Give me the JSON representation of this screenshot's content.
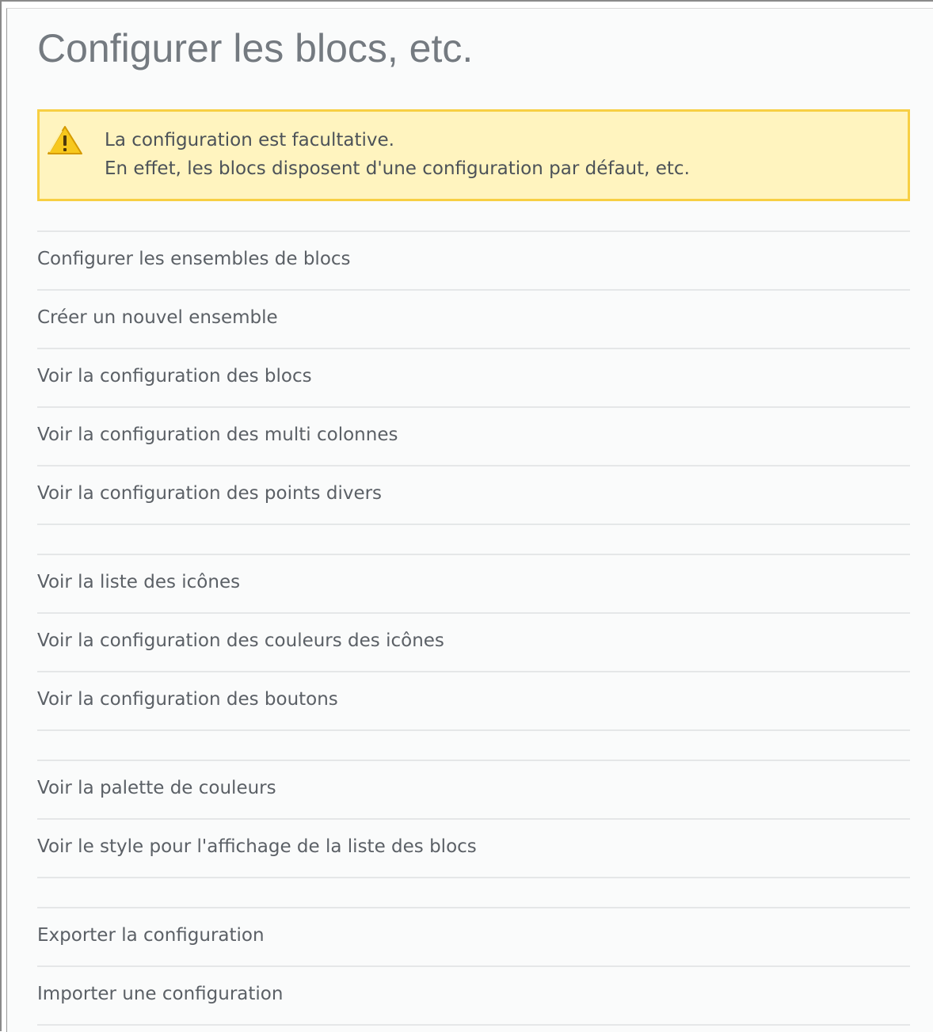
{
  "page": {
    "title": "Configurer les blocs, etc."
  },
  "warning": {
    "icon": "warning-triangle-icon",
    "line1": "La configuration est facultative.",
    "line2": "En effet, les blocs disposent d'une configuration par défaut, etc."
  },
  "menu": {
    "items": [
      {
        "label": "Configurer les ensembles de blocs"
      },
      {
        "label": "Créer un nouvel ensemble"
      },
      {
        "label": "Voir la configuration des blocs"
      },
      {
        "label": "Voir la configuration des multi colonnes"
      },
      {
        "label": "Voir la configuration des points divers"
      },
      {
        "label": "Voir la liste des icônes"
      },
      {
        "label": "Voir la configuration des couleurs des icônes"
      },
      {
        "label": "Voir la configuration des boutons"
      },
      {
        "label": "Voir la palette de couleurs"
      },
      {
        "label": "Voir le style pour l'affichage de la liste des blocs"
      },
      {
        "label": "Exporter la configuration"
      },
      {
        "label": "Importer une configuration"
      }
    ]
  },
  "colors": {
    "warning_background": "#fff4bf",
    "warning_border": "#f7cf43",
    "link_text": "#5b6066",
    "title_text": "#747a80",
    "divider": "#e5e7e8"
  }
}
